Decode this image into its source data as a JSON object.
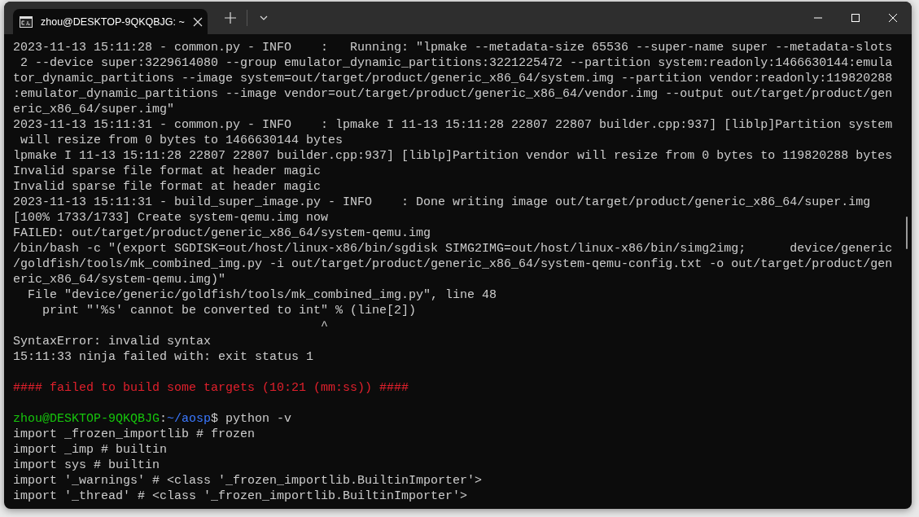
{
  "window": {
    "tab_title": "zhou@DESKTOP-9QKQBJG: ~"
  },
  "terminal": {
    "lines": [
      {
        "kind": "output",
        "text": "2023-11-13 15:11:28 - common.py - INFO    :   Running: \"lpmake --metadata-size 65536 --super-name super --metadata-slots"
      },
      {
        "kind": "output",
        "text": " 2 --device super:3229614080 --group emulator_dynamic_partitions:3221225472 --partition system:readonly:1466630144:emula"
      },
      {
        "kind": "output",
        "text": "tor_dynamic_partitions --image system=out/target/product/generic_x86_64/system.img --partition vendor:readonly:119820288"
      },
      {
        "kind": "output",
        "text": ":emulator_dynamic_partitions --image vendor=out/target/product/generic_x86_64/vendor.img --output out/target/product/gen"
      },
      {
        "kind": "output",
        "text": "eric_x86_64/super.img\""
      },
      {
        "kind": "output",
        "text": "2023-11-13 15:11:31 - common.py - INFO    : lpmake I 11-13 15:11:28 22807 22807 builder.cpp:937] [liblp]Partition system"
      },
      {
        "kind": "output",
        "text": " will resize from 0 bytes to 1466630144 bytes"
      },
      {
        "kind": "output",
        "text": "lpmake I 11-13 15:11:28 22807 22807 builder.cpp:937] [liblp]Partition vendor will resize from 0 bytes to 119820288 bytes"
      },
      {
        "kind": "output",
        "text": "Invalid sparse file format at header magic"
      },
      {
        "kind": "output",
        "text": "Invalid sparse file format at header magic"
      },
      {
        "kind": "output",
        "text": "2023-11-13 15:11:31 - build_super_image.py - INFO    : Done writing image out/target/product/generic_x86_64/super.img"
      },
      {
        "kind": "output",
        "text": "[100% 1733/1733] Create system-qemu.img now"
      },
      {
        "kind": "output",
        "text": "FAILED: out/target/product/generic_x86_64/system-qemu.img"
      },
      {
        "kind": "output",
        "text": "/bin/bash -c \"(export SGDISK=out/host/linux-x86/bin/sgdisk SIMG2IMG=out/host/linux-x86/bin/simg2img;      device/generic"
      },
      {
        "kind": "output",
        "text": "/goldfish/tools/mk_combined_img.py -i out/target/product/generic_x86_64/system-qemu-config.txt -o out/target/product/gen"
      },
      {
        "kind": "output",
        "text": "eric_x86_64/system-qemu.img)\""
      },
      {
        "kind": "output",
        "text": "  File \"device/generic/goldfish/tools/mk_combined_img.py\", line 48"
      },
      {
        "kind": "output",
        "text": "    print \"'%s' cannot be converted to int\" % (line[2])"
      },
      {
        "kind": "output",
        "text": "                                          ^"
      },
      {
        "kind": "output",
        "text": "SyntaxError: invalid syntax"
      },
      {
        "kind": "output",
        "text": "15:11:33 ninja failed with: exit status 1"
      },
      {
        "kind": "blank"
      },
      {
        "kind": "error",
        "text": "#### failed to build some targets (10:21 (mm:ss)) ####"
      },
      {
        "kind": "blank"
      },
      {
        "kind": "prompt",
        "user_host": "zhou@DESKTOP-9QKQBJG",
        "separator": ":",
        "path": "~/aosp",
        "symbol": "$",
        "command": "python -v"
      },
      {
        "kind": "output",
        "text": "import _frozen_importlib # frozen"
      },
      {
        "kind": "output",
        "text": "import _imp # builtin"
      },
      {
        "kind": "output",
        "text": "import sys # builtin"
      },
      {
        "kind": "output",
        "text": "import '_warnings' # <class '_frozen_importlib.BuiltinImporter'>"
      },
      {
        "kind": "output",
        "text": "import '_thread' # <class '_frozen_importlib.BuiltinImporter'>"
      }
    ]
  }
}
